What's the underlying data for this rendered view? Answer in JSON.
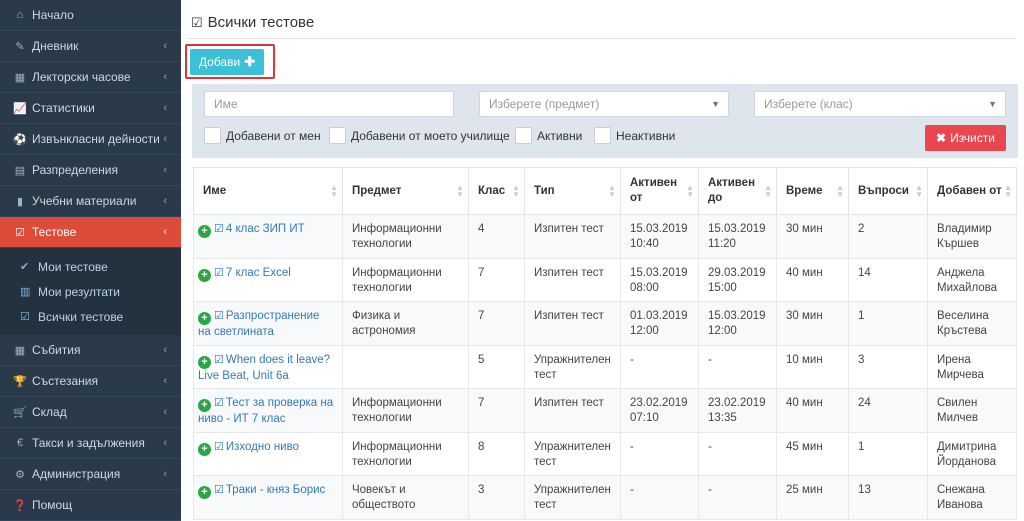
{
  "sidebar": {
    "items": [
      {
        "label": "Начало",
        "icon": "home-icon",
        "glyph": "⌂",
        "chevron": false
      },
      {
        "label": "Дневник",
        "icon": "edit-icon",
        "glyph": "✎",
        "chevron": true
      },
      {
        "label": "Лекторски часове",
        "icon": "calendar-icon",
        "glyph": "▦",
        "chevron": true
      },
      {
        "label": "Статистики",
        "icon": "chart-icon",
        "glyph": "📈",
        "chevron": true
      },
      {
        "label": "Извънкласни дейности",
        "icon": "soccer-icon",
        "glyph": "⚽",
        "chevron": true
      },
      {
        "label": "Разпределения",
        "icon": "list-icon",
        "glyph": "▤",
        "chevron": true
      },
      {
        "label": "Учебни материали",
        "icon": "book-icon",
        "glyph": "▮",
        "chevron": true
      },
      {
        "label": "Тестове",
        "icon": "checkbox-icon",
        "glyph": "☑",
        "chevron": true,
        "active": true
      }
    ],
    "sub_items": [
      {
        "label": "Мои тестове",
        "icon": "check-icon",
        "glyph": "✔"
      },
      {
        "label": "Мои резултати",
        "icon": "bar-chart-icon",
        "glyph": "▥"
      },
      {
        "label": "Всички тестове",
        "icon": "checkbox-icon",
        "glyph": "☑"
      }
    ],
    "items_after": [
      {
        "label": "Събития",
        "icon": "calendar-icon",
        "glyph": "▦",
        "chevron": true
      },
      {
        "label": "Състезания",
        "icon": "trophy-icon",
        "glyph": "🏆",
        "chevron": true
      },
      {
        "label": "Склад",
        "icon": "cart-icon",
        "glyph": "🛒",
        "chevron": true
      },
      {
        "label": "Такси и задължения",
        "icon": "euro-icon",
        "glyph": "€",
        "chevron": true
      },
      {
        "label": "Администрация",
        "icon": "cogs-icon",
        "glyph": "⚙",
        "chevron": true
      },
      {
        "label": "Помощ",
        "icon": "question-icon",
        "glyph": "❓",
        "chevron": false
      }
    ]
  },
  "page": {
    "title": "Всички тестове",
    "add_button": "Добави"
  },
  "filters": {
    "name_placeholder": "Име",
    "subject_placeholder": "Изберете (предмет)",
    "class_placeholder": "Изберете (клас)",
    "added_by_me": "Добавени от мен",
    "added_by_school": "Добавени от моето училище",
    "active": "Активни",
    "inactive": "Неактивни",
    "clear_button": "Изчисти"
  },
  "table": {
    "headers": [
      "Име",
      "Предмет",
      "Клас",
      "Тип",
      "Активен от",
      "Активен до",
      "Време",
      "Въпроси",
      "Добавен от"
    ],
    "rows": [
      {
        "name": "4 клас ЗИП ИТ",
        "subject": "Информационни технологии",
        "class": "4",
        "type": "Изпитен тест",
        "from": "15.03.2019 10:40",
        "to": "15.03.2019 11:20",
        "time": "30 мин",
        "questions": "2",
        "author": "Владимир Кършев"
      },
      {
        "name": "7 клас Excel",
        "subject": "Информационни технологии",
        "class": "7",
        "type": "Изпитен тест",
        "from": "15.03.2019 08:00",
        "to": "29.03.2019 15:00",
        "time": "40 мин",
        "questions": "14",
        "author": "Анджела Михайлова"
      },
      {
        "name": "Разпространение на светлината",
        "subject": "Физика и астрономия",
        "class": "7",
        "type": "Изпитен тест",
        "from": "01.03.2019 12:00",
        "to": "15.03.2019 12:00",
        "time": "30 мин",
        "questions": "1",
        "author": "Веселина Кръстева"
      },
      {
        "name": "When does it leave? Live Beat, Unit 6a",
        "subject": "",
        "class": "5",
        "type": "Упражнителен тест",
        "from": "-",
        "to": "-",
        "time": "10 мин",
        "questions": "3",
        "author": "Ирена Мирчева"
      },
      {
        "name": "Тест за проверка на ниво - ИТ 7 клас",
        "subject": "Информационни технологии",
        "class": "7",
        "type": "Изпитен тест",
        "from": "23.02.2019 07:10",
        "to": "23.02.2019 13:35",
        "time": "40 мин",
        "questions": "24",
        "author": "Свилен Милчев"
      },
      {
        "name": "Изходно ниво",
        "subject": "Информационни технологии",
        "class": "8",
        "type": "Упражнителен тест",
        "from": "-",
        "to": "-",
        "time": "45 мин",
        "questions": "1",
        "author": "Димитрина Йорданова"
      },
      {
        "name": "Траки - княз Борис",
        "subject": "Човекът и обществото",
        "class": "3",
        "type": "Упражнителен тест",
        "from": "-",
        "to": "-",
        "time": "25 мин",
        "questions": "13",
        "author": "Снежана Иванова"
      }
    ]
  },
  "colors": {
    "sidebar_bg": "#2b3a4a",
    "active_item": "#dd4b39",
    "add_button": "#3bc0d7",
    "clear_button": "#e9474f",
    "link": "#337ab7",
    "plus_badge": "#29a745"
  }
}
